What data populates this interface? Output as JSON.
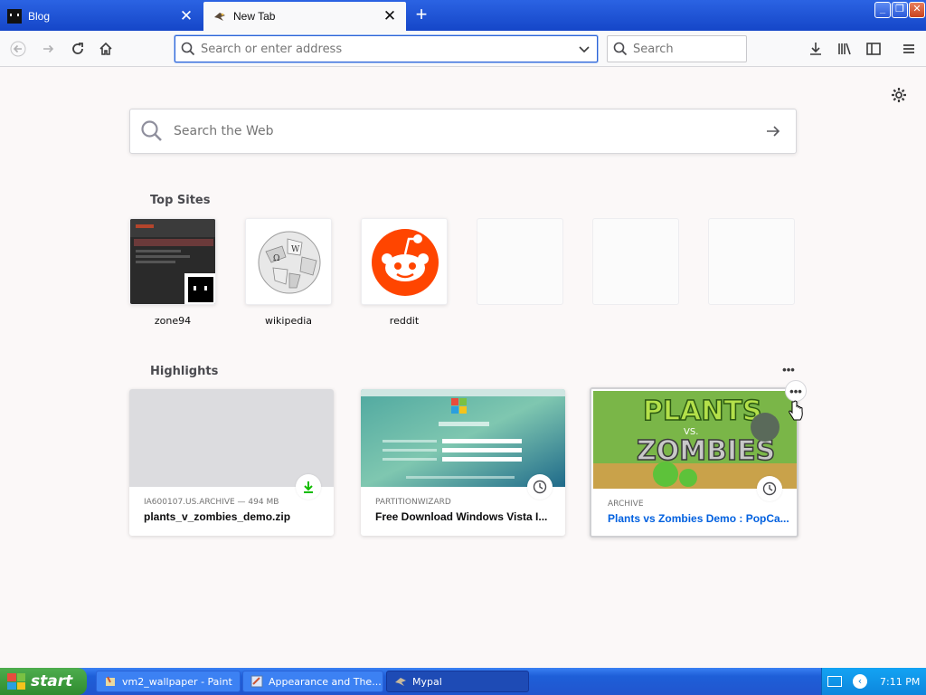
{
  "tabs": [
    {
      "title": "Blog",
      "favicon": "blog-favicon",
      "active": false
    },
    {
      "title": "New Tab",
      "favicon": "mypal-favicon",
      "active": true
    }
  ],
  "toolbar": {
    "url_placeholder": "Search or enter address",
    "search_placeholder": "Search"
  },
  "newtab": {
    "web_search_placeholder": "Search the Web",
    "top_sites_title": "Top Sites",
    "top_sites": [
      {
        "label": "zone94"
      },
      {
        "label": "wikipedia"
      },
      {
        "label": "reddit"
      },
      {
        "label": ""
      },
      {
        "label": ""
      },
      {
        "label": ""
      }
    ],
    "highlights_title": "Highlights",
    "highlights": [
      {
        "meta": "IA600107.US.ARCHIVE — 494 MB",
        "title": "plants_v_zombies_demo.zip",
        "badge": "download-icon"
      },
      {
        "meta": "PARTITIONWIZARD",
        "title": "Free Download Windows Vista I...",
        "badge": "clock-icon"
      },
      {
        "meta": "ARCHIVE",
        "title": "Plants vs Zombies Demo : PopCa...",
        "badge": "clock-icon"
      }
    ]
  },
  "taskbar": {
    "start_label": "start",
    "tasks": [
      {
        "label": "vm2_wallpaper - Paint"
      },
      {
        "label": "Appearance and The..."
      },
      {
        "label": "Mypal"
      }
    ],
    "clock": "7:11 PM"
  },
  "colors": {
    "tab_strip": "#1a4fd0",
    "accent_blue": "#0a84ff",
    "reddit_orange": "#ff4500",
    "download_green": "#12bc00",
    "link_blue": "#0060df"
  }
}
